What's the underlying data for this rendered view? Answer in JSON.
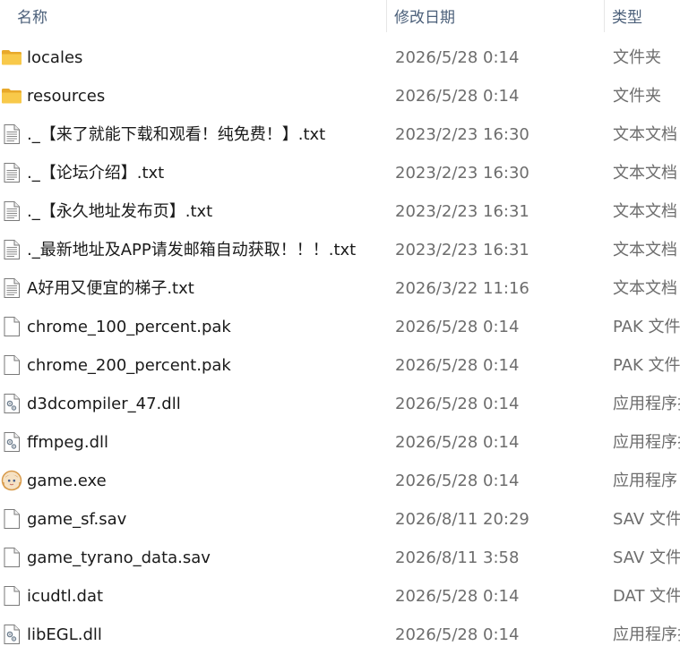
{
  "header": {
    "sort_indicator": "^",
    "col_name": "名称",
    "col_date": "修改日期",
    "col_type": "类型"
  },
  "files": [
    {
      "name": "locales",
      "date": "2026/5/28 0:14",
      "type": "文件夹",
      "icon": "folder-icon"
    },
    {
      "name": "resources",
      "date": "2026/5/28 0:14",
      "type": "文件夹",
      "icon": "folder-icon"
    },
    {
      "name": "._【来了就能下载和观看！纯免费！】.txt",
      "date": "2023/2/23 16:30",
      "type": "文本文档",
      "icon": "text-file-icon"
    },
    {
      "name": "._【论坛介绍】.txt",
      "date": "2023/2/23 16:30",
      "type": "文本文档",
      "icon": "text-file-icon"
    },
    {
      "name": "._【永久地址发布页】.txt",
      "date": "2023/2/23 16:31",
      "type": "文本文档",
      "icon": "text-file-icon"
    },
    {
      "name": "._最新地址及APP请发邮箱自动获取！！！.txt",
      "date": "2023/2/23 16:31",
      "type": "文本文档",
      "icon": "text-file-icon"
    },
    {
      "name": "A好用又便宜的梯子.txt",
      "date": "2026/3/22 11:16",
      "type": "文本文档",
      "icon": "text-file-icon"
    },
    {
      "name": "chrome_100_percent.pak",
      "date": "2026/5/28 0:14",
      "type": "PAK 文件",
      "icon": "blank-file-icon"
    },
    {
      "name": "chrome_200_percent.pak",
      "date": "2026/5/28 0:14",
      "type": "PAK 文件",
      "icon": "blank-file-icon"
    },
    {
      "name": "d3dcompiler_47.dll",
      "date": "2026/5/28 0:14",
      "type": "应用程序扩展",
      "icon": "dll-file-icon"
    },
    {
      "name": "ffmpeg.dll",
      "date": "2026/5/28 0:14",
      "type": "应用程序扩展",
      "icon": "dll-file-icon"
    },
    {
      "name": "game.exe",
      "date": "2026/5/28 0:14",
      "type": "应用程序",
      "icon": "app-exe-icon"
    },
    {
      "name": "game_sf.sav",
      "date": "2026/8/11 20:29",
      "type": "SAV 文件",
      "icon": "blank-file-icon"
    },
    {
      "name": "game_tyrano_data.sav",
      "date": "2026/8/11 3:58",
      "type": "SAV 文件",
      "icon": "blank-file-icon"
    },
    {
      "name": "icudtl.dat",
      "date": "2026/5/28 0:14",
      "type": "DAT 文件",
      "icon": "blank-file-icon"
    },
    {
      "name": "libEGL.dll",
      "date": "2026/5/28 0:14",
      "type": "应用程序扩展",
      "icon": "dll-file-icon"
    }
  ],
  "colors": {
    "header_text": "#4c607a",
    "name_text": "#1a1a1a",
    "meta_text": "#6d6d6d",
    "folder_yellow": "#f8c94a",
    "separator": "#e6e6e6"
  }
}
